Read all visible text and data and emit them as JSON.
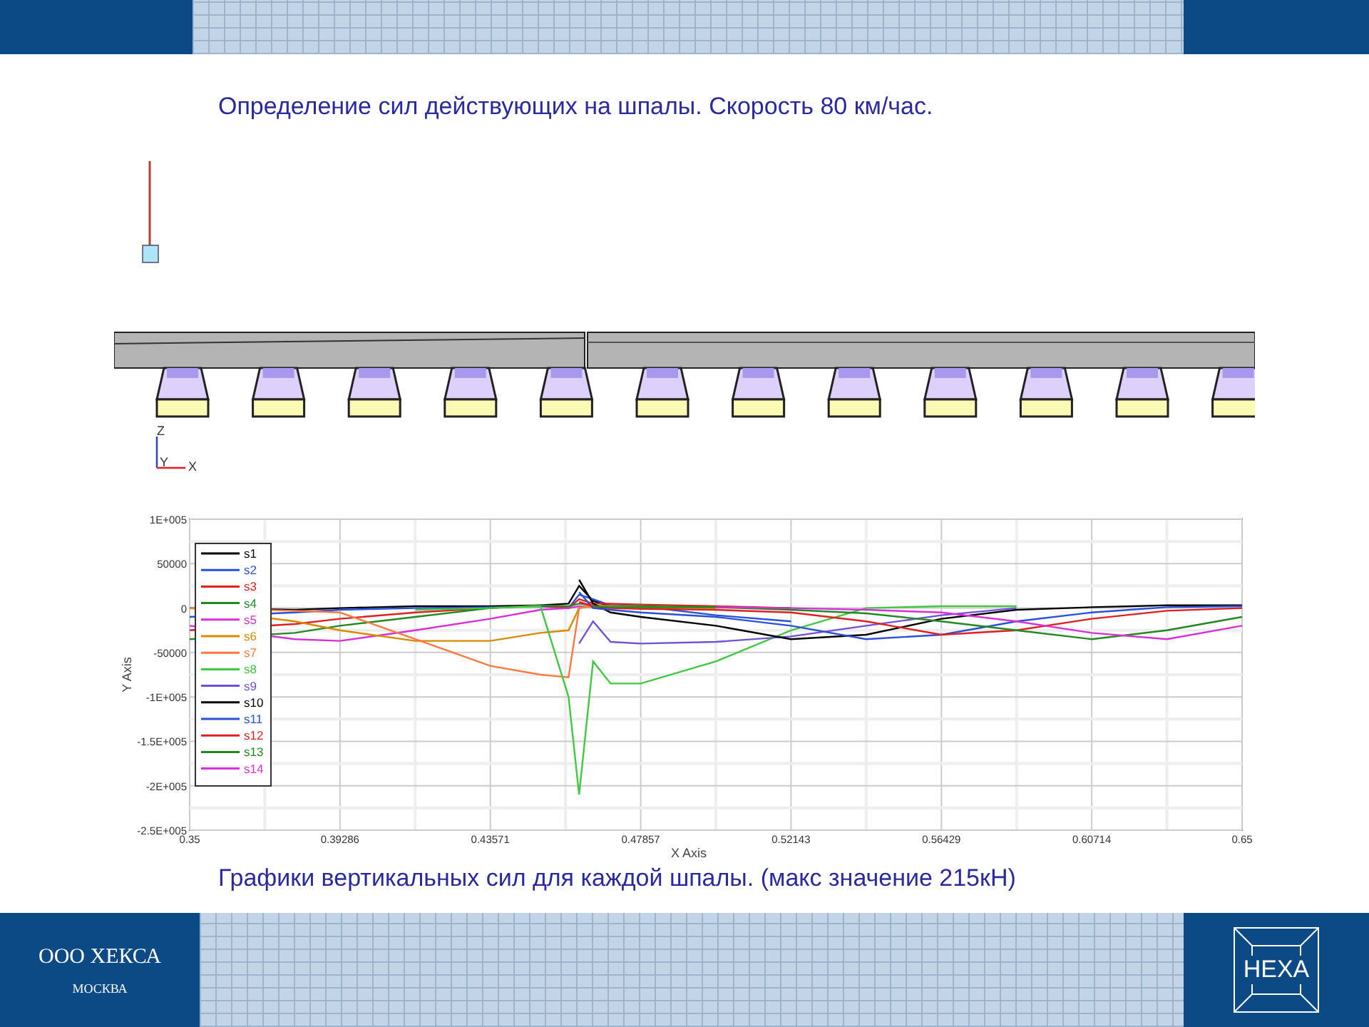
{
  "title": "Определение сил действующих на шпалы. Скорость 80 км/час.",
  "model": {
    "axis_labels": [
      "Z",
      "Y",
      "X"
    ]
  },
  "chart": {
    "chart_data": {
      "type": "line",
      "xlabel": "X Axis",
      "ylabel": "Y Axis",
      "x": [
        0.35,
        0.38,
        0.39286,
        0.41429,
        0.43571,
        0.45,
        0.458,
        0.461,
        0.465,
        0.47,
        0.47857,
        0.5,
        0.52143,
        0.54286,
        0.56429,
        0.58571,
        0.60714,
        0.62857,
        0.65
      ],
      "series": [
        {
          "name": "s1",
          "color": "#000000",
          "values": [
            0,
            -2000,
            0,
            2000,
            2000,
            3000,
            5000,
            25000,
            8000,
            2000,
            0,
            null,
            null,
            null,
            null,
            null,
            null,
            null,
            null
          ]
        },
        {
          "name": "s2",
          "color": "#2850d8",
          "values": [
            -10000,
            -5000,
            -2000,
            0,
            1000,
            2000,
            0,
            15000,
            10000,
            3000,
            2000,
            -8000,
            -15000,
            null,
            null,
            null,
            null,
            null,
            null
          ]
        },
        {
          "name": "s3",
          "color": "#e02020",
          "values": [
            -25000,
            -18000,
            -12000,
            -5000,
            0,
            3000,
            0,
            10000,
            5000,
            5000,
            4000,
            2000,
            0,
            null,
            null,
            null,
            null,
            null,
            null
          ]
        },
        {
          "name": "s4",
          "color": "#208a20",
          "values": [
            -35000,
            -28000,
            -20000,
            -10000,
            0,
            3000,
            2000,
            5000,
            3000,
            2000,
            2000,
            1000,
            0,
            null,
            null,
            null,
            null,
            null,
            null
          ]
        },
        {
          "name": "s5",
          "color": "#d830d8",
          "values": [
            -20000,
            -35000,
            -37000,
            -25000,
            -12000,
            -2000,
            0,
            2000,
            1000,
            0,
            null,
            null,
            null,
            null,
            null,
            null,
            null,
            null,
            null
          ]
        },
        {
          "name": "s6",
          "color": "#d88a00",
          "values": [
            0,
            -15000,
            -25000,
            -37000,
            -37000,
            -28000,
            -25000,
            0,
            3000,
            2000,
            1000,
            0,
            null,
            null,
            null,
            null,
            null,
            null,
            null
          ]
        },
        {
          "name": "s7",
          "color": "#ff7840",
          "values": [
            0,
            -3000,
            -5000,
            -35000,
            -65000,
            -75000,
            -78000,
            0,
            2000,
            1000,
            0,
            null,
            null,
            null,
            null,
            null,
            null,
            null,
            null
          ]
        },
        {
          "name": "s8",
          "color": "#40c840",
          "values": [
            null,
            null,
            null,
            -2000,
            0,
            2000,
            -100000,
            -210000,
            -60000,
            -85000,
            -85000,
            -60000,
            -25000,
            0,
            2000,
            2000,
            null,
            null,
            null
          ]
        },
        {
          "name": "s9",
          "color": "#7050d8",
          "values": [
            null,
            null,
            null,
            null,
            null,
            null,
            null,
            -40000,
            -15000,
            -38000,
            -40000,
            -38000,
            -32000,
            -20000,
            -8000,
            0,
            null,
            null,
            null
          ]
        },
        {
          "name": "s10",
          "color": "#000000",
          "values": [
            null,
            null,
            null,
            null,
            null,
            null,
            null,
            32000,
            5000,
            -5000,
            -10000,
            -20000,
            -35000,
            -30000,
            -12000,
            -2000,
            1000,
            3000,
            3000
          ]
        },
        {
          "name": "s11",
          "color": "#2850d8",
          "values": [
            null,
            null,
            null,
            null,
            null,
            null,
            null,
            18000,
            0,
            -2000,
            -5000,
            -10000,
            -20000,
            -35000,
            -30000,
            -15000,
            -5000,
            1000,
            2000
          ]
        },
        {
          "name": "s12",
          "color": "#e02020",
          "values": [
            null,
            null,
            null,
            null,
            null,
            null,
            null,
            7000,
            2000,
            0,
            -1000,
            -2000,
            -5000,
            -15000,
            -30000,
            -25000,
            -12000,
            -3000,
            0
          ]
        },
        {
          "name": "s13",
          "color": "#208a20",
          "values": [
            null,
            null,
            null,
            null,
            null,
            null,
            null,
            null,
            2000,
            1000,
            1000,
            1000,
            -2000,
            -6000,
            -15000,
            -25000,
            -35000,
            -25000,
            -10000
          ]
        },
        {
          "name": "s14",
          "color": "#d830d8",
          "values": [
            null,
            null,
            null,
            null,
            null,
            null,
            null,
            null,
            null,
            null,
            null,
            1000,
            0,
            -2000,
            -5000,
            -15000,
            -28000,
            -35000,
            -20000
          ]
        }
      ],
      "grid": true,
      "legend": true,
      "xlim": [
        0.35,
        0.65
      ],
      "ylim": [
        -250000,
        100000
      ],
      "xticks": [
        0.35,
        0.39286,
        0.43571,
        0.47857,
        0.52143,
        0.56429,
        0.60714,
        0.65
      ],
      "yticks": [
        {
          "value": 100000,
          "label": "1E+005"
        },
        {
          "value": 50000,
          "label": "50000"
        },
        {
          "value": 0,
          "label": "0"
        },
        {
          "value": -50000,
          "label": "-50000"
        },
        {
          "value": -100000,
          "label": "-1E+005"
        },
        {
          "value": -150000,
          "label": "-1.5E+005"
        },
        {
          "value": -200000,
          "label": "-2E+005"
        },
        {
          "value": -250000,
          "label": "-2.5E+005"
        }
      ]
    }
  },
  "caption": "Графики вертикальных сил для каждой шпалы. (макс значение 215кН)",
  "footer": {
    "company": "ООО ХЕКСА",
    "city": "МОСКВА",
    "logo": "HEXA"
  }
}
